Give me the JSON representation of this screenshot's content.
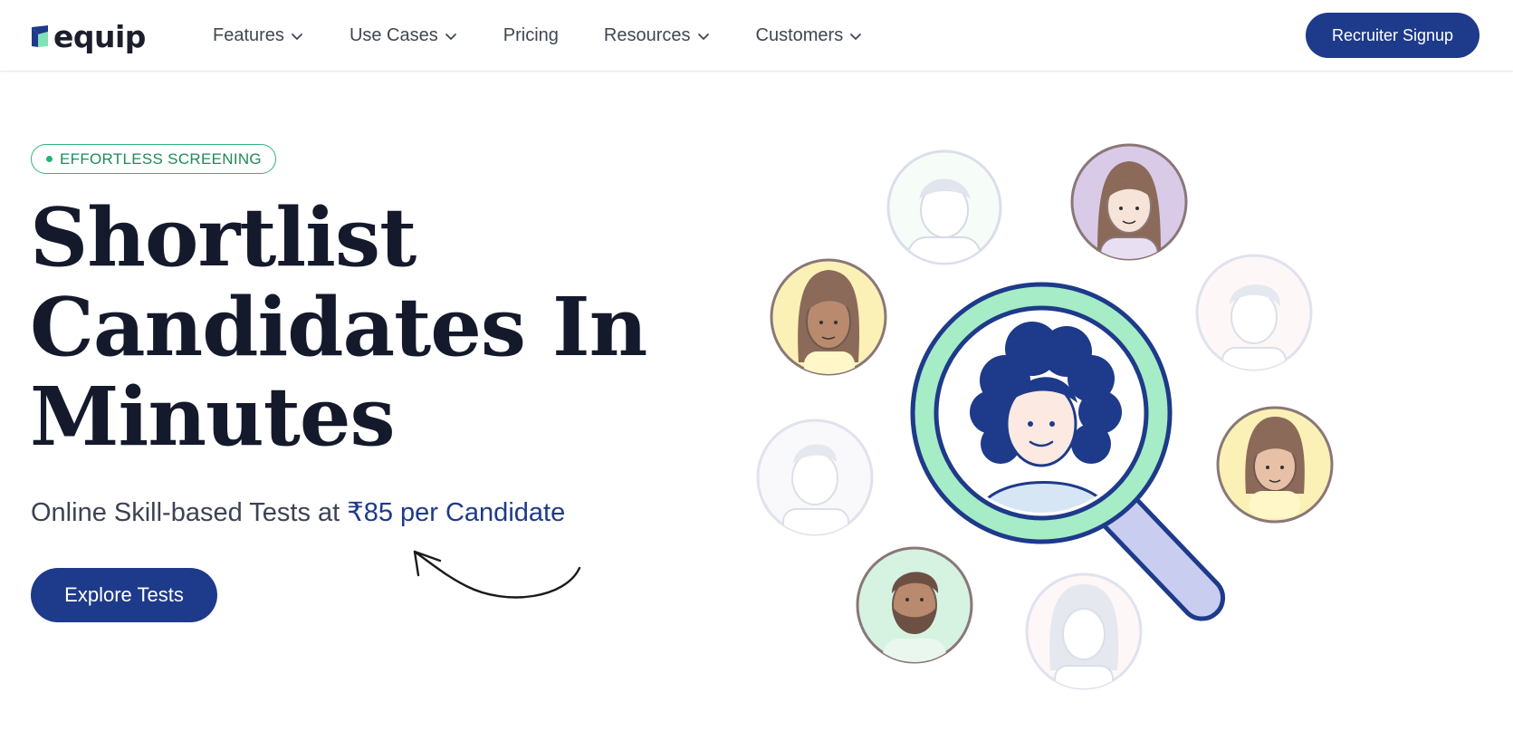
{
  "brand": {
    "name": "equip",
    "accent": "#1e3a8a",
    "accent_green": "#22b573"
  },
  "nav": {
    "items": [
      {
        "label": "Features",
        "has_dropdown": true
      },
      {
        "label": "Use Cases",
        "has_dropdown": true
      },
      {
        "label": "Pricing",
        "has_dropdown": false
      },
      {
        "label": "Resources",
        "has_dropdown": true
      },
      {
        "label": "Customers",
        "has_dropdown": true
      }
    ],
    "cta_label": "Recruiter Signup"
  },
  "hero": {
    "badge": "EFFORTLESS SCREENING",
    "headline_lines": [
      "Shortlist",
      "Candidates In",
      "Minutes"
    ],
    "subline_prefix": "Online Skill-based Tests at ",
    "subline_highlight": "₹85 per Candidate",
    "cta_label": "Explore Tests"
  },
  "illustration": {
    "main": "magnifying-glass-candidate",
    "avatars": [
      "man-faded",
      "woman-purple",
      "woman-yellow",
      "man-faded-right",
      "man-faded-left",
      "woman-yellow-right",
      "bearded-man-green",
      "woman-faded-bottom"
    ]
  }
}
